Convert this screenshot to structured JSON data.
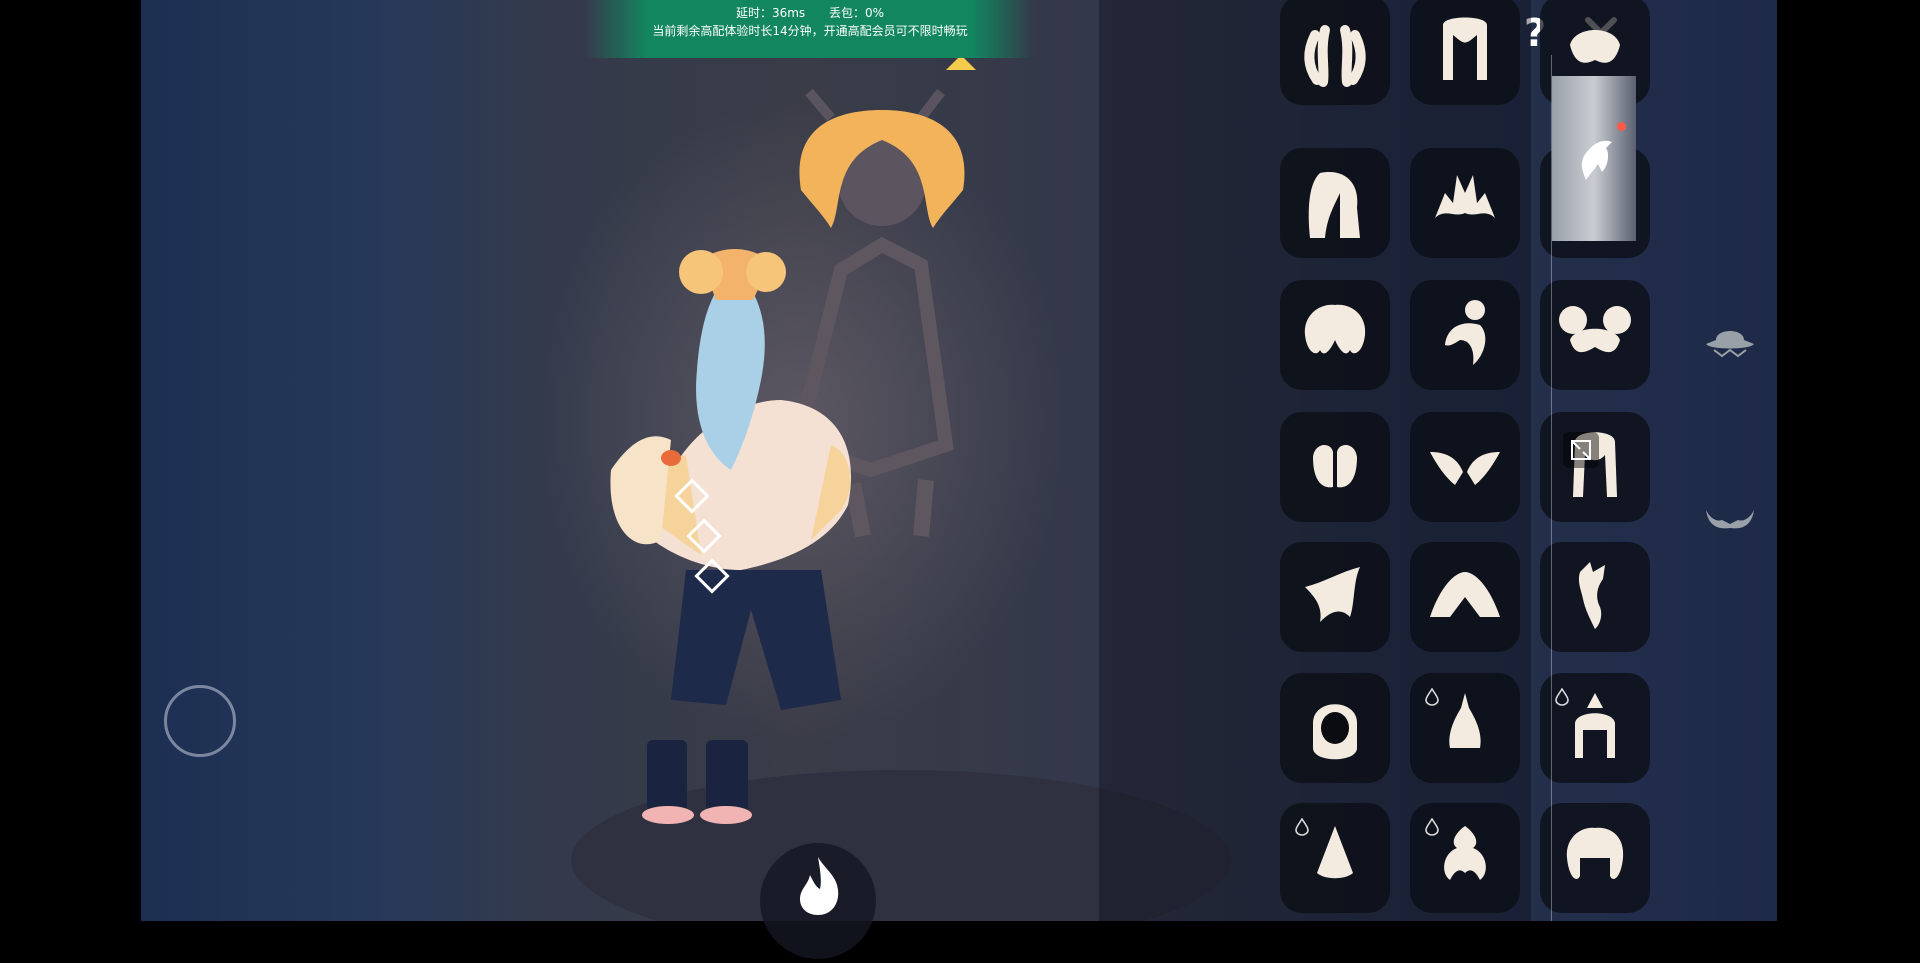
{
  "status_banner": {
    "latency_label": "延时：36ms",
    "packet_loss_label": "丢包：0%",
    "notice": "当前剩余高配体验时长14分钟，开通高配会员可不限时畅玩"
  },
  "controls": {
    "help_label": "?",
    "close_icon": "close-icon",
    "joystick": "virtual-joystick",
    "fire_icon": "flame-icon",
    "expand_icon": "expand-icon"
  },
  "category_tabs": [
    {
      "name": "hair",
      "icon": "hair-icon",
      "active": true,
      "has_notification": true
    },
    {
      "name": "hat",
      "icon": "hat-icon",
      "active": false
    },
    {
      "name": "horns",
      "icon": "horns-icon",
      "active": false
    }
  ],
  "hairstyle_grid": {
    "items": [
      {
        "icon": "hair-braids-icon",
        "premium": false
      },
      {
        "icon": "hair-long-straight-icon",
        "premium": false
      },
      {
        "icon": "hair-short-bob-icon",
        "premium": false
      },
      {
        "icon": "hair-side-long-icon",
        "premium": false
      },
      {
        "icon": "hair-spiky-icon",
        "premium": false
      },
      {
        "icon": "hair-fluffy-icon",
        "premium": false
      },
      {
        "icon": "hair-curly-icon",
        "premium": false
      },
      {
        "icon": "hair-topknot-icon",
        "premium": false
      },
      {
        "icon": "hair-double-buns-icon",
        "premium": false
      },
      {
        "icon": "hair-parted-short-icon",
        "premium": false
      },
      {
        "icon": "hair-winged-icon",
        "premium": false
      },
      {
        "icon": "hair-long-braided-icon",
        "premium": false
      },
      {
        "icon": "hair-swept-icon",
        "premium": false
      },
      {
        "icon": "hair-wide-cap-icon",
        "premium": false
      },
      {
        "icon": "hair-side-braid-icon",
        "premium": false
      },
      {
        "icon": "hair-hood-icon",
        "premium": false
      },
      {
        "icon": "hair-tall-bun-icon",
        "premium": true
      },
      {
        "icon": "hair-ornament-headdress-icon",
        "premium": true
      },
      {
        "icon": "hair-cone-icon",
        "premium": true
      },
      {
        "icon": "hair-leaf-bun-icon",
        "premium": true
      },
      {
        "icon": "hair-curly-bob-icon",
        "premium": false
      }
    ]
  },
  "colors": {
    "banner": "#108a60",
    "icon_fill": "#f4ebe0",
    "notification": "#ff5a4a"
  }
}
